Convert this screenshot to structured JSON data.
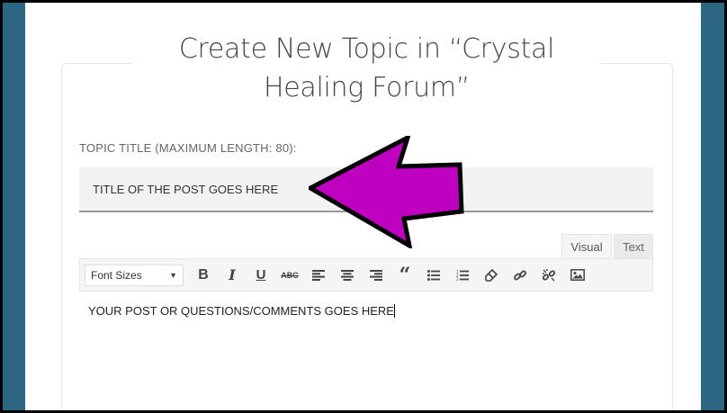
{
  "page": {
    "title": "Create New Topic in “Crystal Healing Forum”"
  },
  "form": {
    "title_label": "TOPIC TITLE (MAXIMUM LENGTH: 80):",
    "title_value": "TITLE OF THE POST GOES HERE",
    "editor_tabs": {
      "visual": "Visual",
      "text": "Text"
    },
    "toolbar": {
      "font_sizes_label": "Font Sizes",
      "buttons": [
        "bold-icon",
        "italic-icon",
        "underline-icon",
        "strikethrough-icon",
        "align-left-icon",
        "align-center-icon",
        "align-right-icon",
        "blockquote-icon",
        "bullet-list-icon",
        "numbered-list-icon",
        "eraser-icon",
        "link-icon",
        "unlink-icon",
        "image-icon"
      ]
    },
    "editor_content": "YOUR POST OR QUESTIONS/COMMENTS GOES HERE"
  },
  "colors": {
    "side_background": "#2b6782",
    "annotation_arrow": "#c000c0"
  }
}
